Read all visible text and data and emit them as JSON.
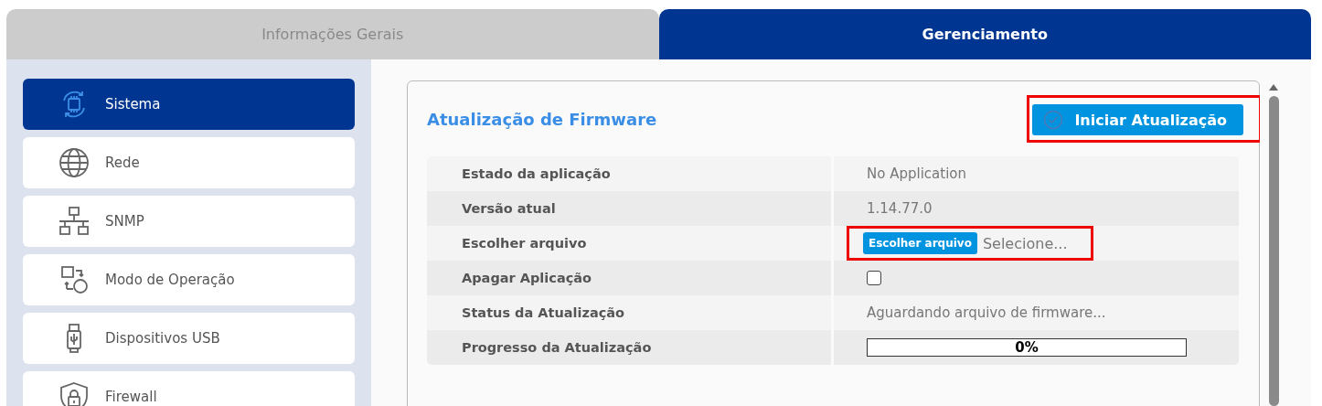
{
  "tabs": [
    {
      "label": "Informações Gerais",
      "selected": false
    },
    {
      "label": "Gerenciamento",
      "selected": true
    }
  ],
  "sidebar": {
    "items": [
      {
        "label": "Sistema",
        "selected": true
      },
      {
        "label": "Rede",
        "selected": false
      },
      {
        "label": "SNMP",
        "selected": false
      },
      {
        "label": "Modo de Operação",
        "selected": false
      },
      {
        "label": "Dispositivos USB",
        "selected": false
      },
      {
        "label": "Firewall",
        "selected": false
      }
    ]
  },
  "panel": {
    "title": "Atualização de Firmware",
    "action_button": "Iniciar Atualização",
    "rows": [
      {
        "kind": "text",
        "label": "Estado da aplicação",
        "value": "No Application"
      },
      {
        "kind": "text",
        "label": "Versão atual",
        "value": "1.14.77.0"
      },
      {
        "kind": "file",
        "label": "Escolher arquivo",
        "button": "Escolher arquivo",
        "placeholder": "Selecione..."
      },
      {
        "kind": "checkbox",
        "label": "Apagar Aplicação",
        "checked": false
      },
      {
        "kind": "text",
        "label": "Status da Atualização",
        "value": "Aguardando arquivo de firmware..."
      },
      {
        "kind": "progress",
        "label": "Progresso da Atualização",
        "level": 0,
        "reading": "0%"
      }
    ]
  }
}
